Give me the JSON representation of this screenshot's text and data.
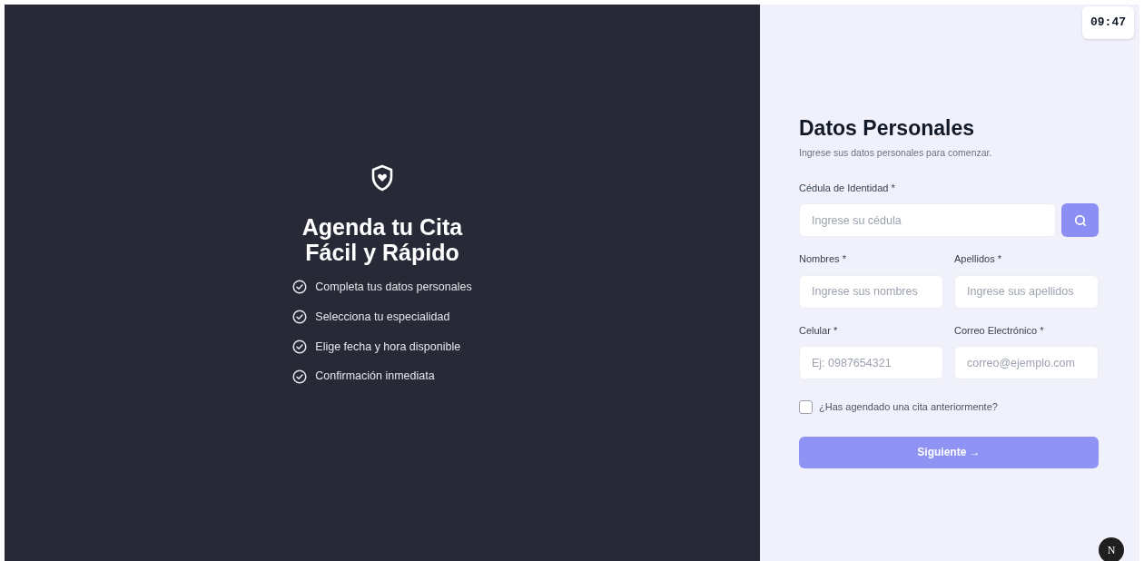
{
  "hero": {
    "title_lines": [
      "Agenda tu Cita",
      "Fácil y Rápido"
    ],
    "features": [
      "Completa tus datos personales",
      "Selecciona tu especialidad",
      "Elige fecha y hora disponible",
      "Confirmación inmediata"
    ]
  },
  "clock": "09:47",
  "form": {
    "title": "Datos Personales",
    "subtitle": "Ingrese sus datos personales para comenzar.",
    "id_field": {
      "label": "Cédula de Identidad *",
      "placeholder": "Ingrese su cédula"
    },
    "rows": [
      [
        {
          "label": "Nombres *",
          "placeholder": "Ingrese sus nombres"
        },
        {
          "label": "Apellidos *",
          "placeholder": "Ingrese sus apellidos"
        }
      ],
      [
        {
          "label": "Celular *",
          "placeholder": "Ej: 0987654321"
        },
        {
          "label": "Correo Electrónico *",
          "placeholder": "correo@ejemplo.com"
        }
      ]
    ],
    "checkbox": {
      "label": "¿Has agendado una cita anteriormente?",
      "checked": false
    },
    "submit": {
      "label": "Siguiente →",
      "disabled": true
    }
  },
  "dev_badge": "N"
}
